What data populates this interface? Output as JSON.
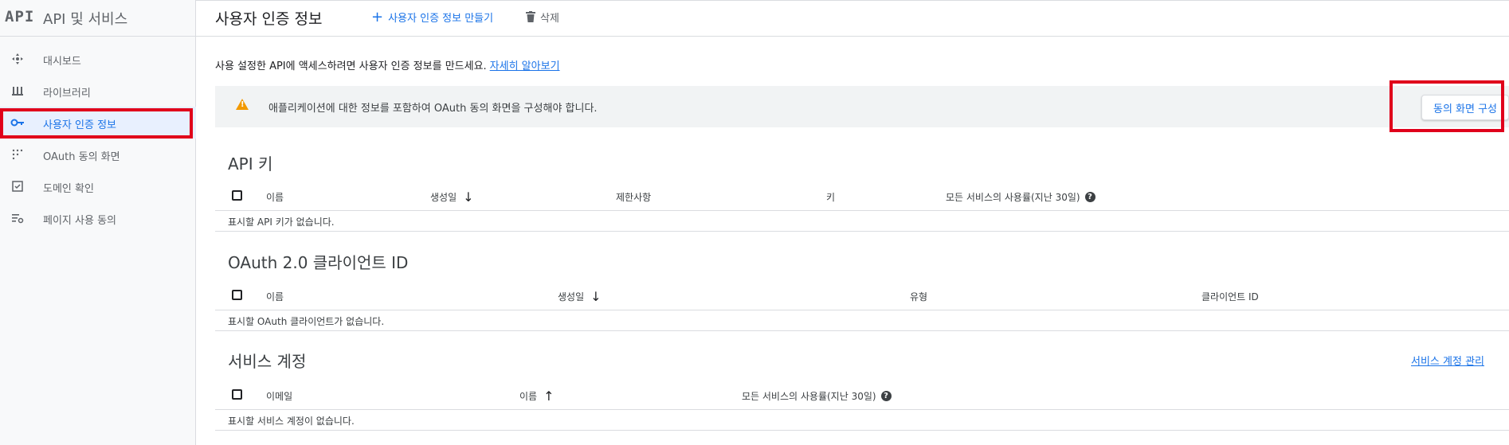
{
  "sidebar": {
    "logo": "API",
    "title": "API 및 서비스",
    "items": [
      {
        "label": "대시보드",
        "icon": "dashboard-icon",
        "active": false
      },
      {
        "label": "라이브러리",
        "icon": "library-icon",
        "active": false
      },
      {
        "label": "사용자 인증 정보",
        "icon": "key-icon",
        "active": true
      },
      {
        "label": "OAuth 동의 화면",
        "icon": "consent-grid-icon",
        "active": false
      },
      {
        "label": "도메인 확인",
        "icon": "checkbox-icon",
        "active": false
      },
      {
        "label": "페이지 사용 동의",
        "icon": "settings-list-icon",
        "active": false
      }
    ]
  },
  "header": {
    "title": "사용자 인증 정보",
    "create_label": "사용자 인증 정보 만들기",
    "delete_label": "삭제"
  },
  "main": {
    "intro_text": "사용 설정한 API에 액세스하려면 사용자 인증 정보를 만드세요.",
    "intro_link": "자세히 알아보기",
    "warning_text": "애플리케이션에 대한 정보를 포함하여 OAuth 동의 화면을 구성해야 합니다.",
    "consent_button": "동의 화면 구성",
    "api_keys": {
      "title": "API 키",
      "columns": [
        "이름",
        "생성일",
        "제한사항",
        "키",
        "모든 서비스의 사용률(지난 30일)"
      ],
      "empty": "표시할 API 키가 없습니다."
    },
    "oauth": {
      "title": "OAuth 2.0 클라이언트 ID",
      "columns": [
        "이름",
        "생성일",
        "유형",
        "클라이언트 ID"
      ],
      "empty": "표시할 OAuth 클라이언트가 없습니다."
    },
    "service_accounts": {
      "title": "서비스 계정",
      "manage_link": "서비스 계정 관리",
      "columns": [
        "이메일",
        "이름",
        "모든 서비스의 사용률(지난 30일)"
      ],
      "empty": "표시할 서비스 계정이 없습니다."
    }
  },
  "colors": {
    "accent": "#1a73e8",
    "highlight": "#e0001b",
    "warning": "#f29900"
  }
}
